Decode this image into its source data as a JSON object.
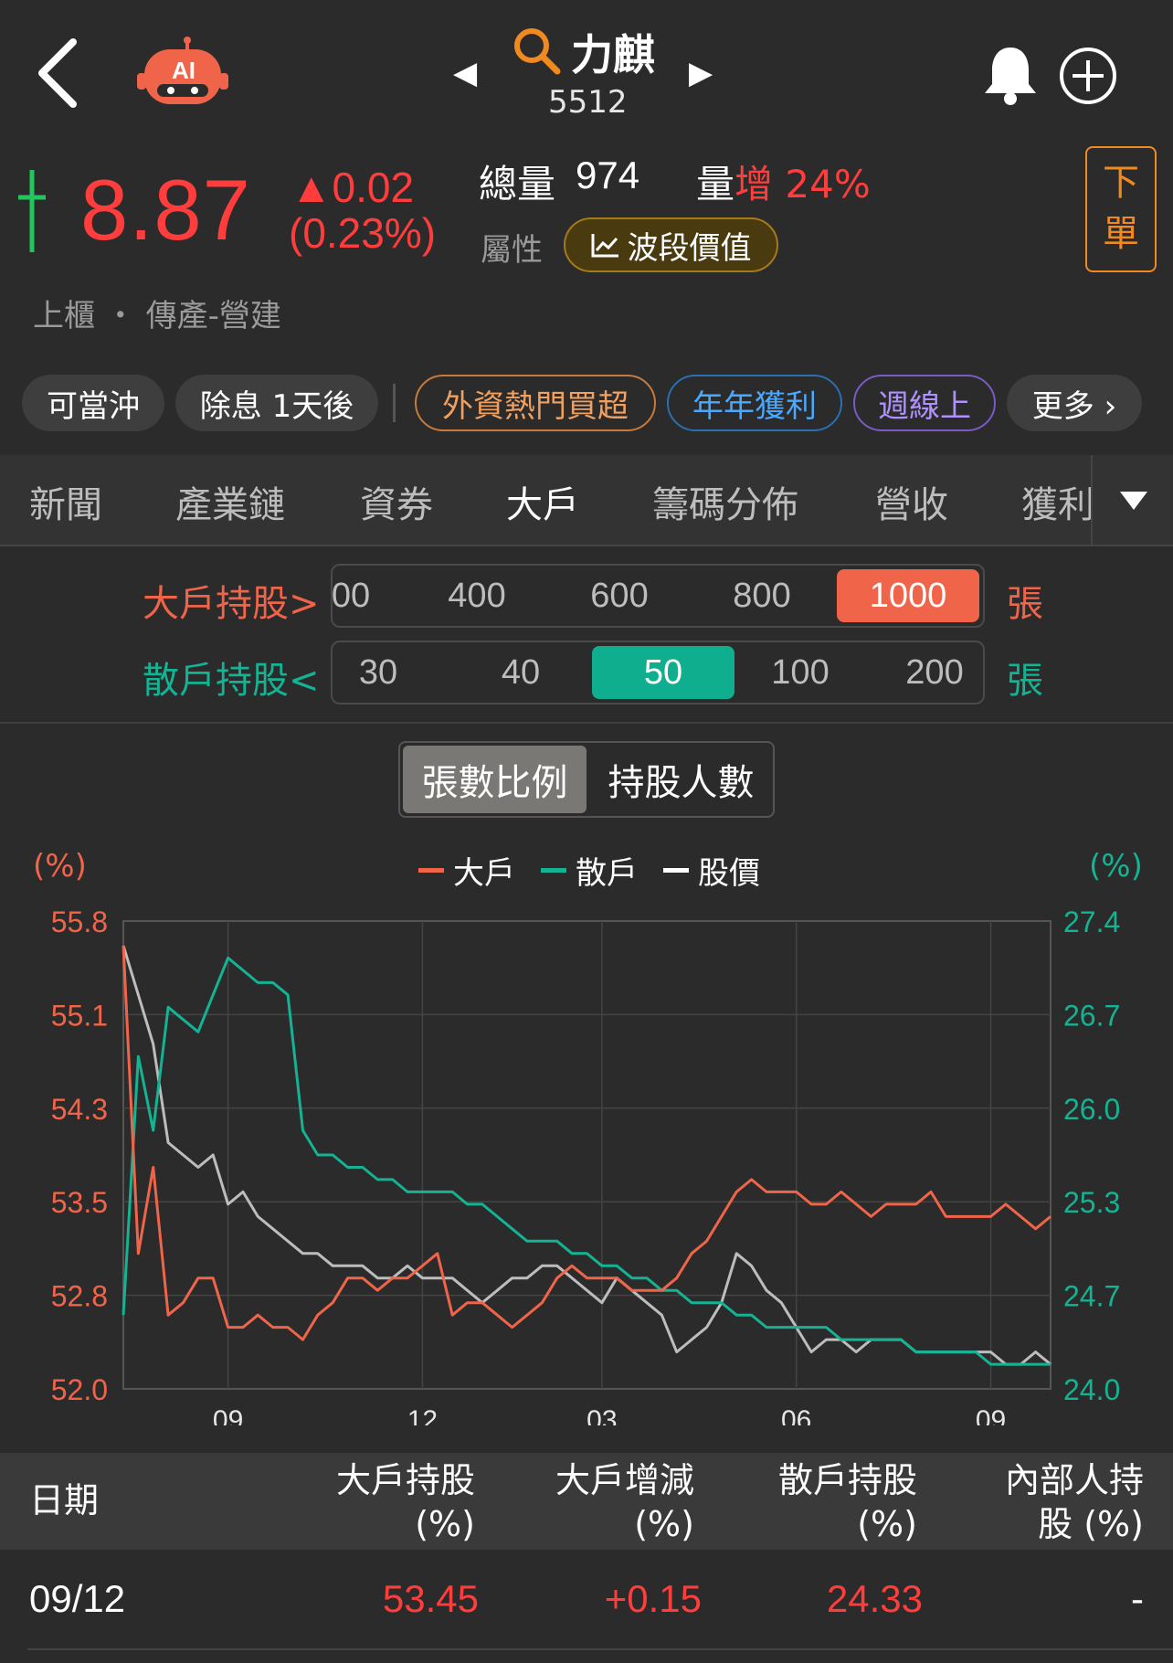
{
  "header": {
    "stock_name": "力麒",
    "stock_code": "5512",
    "prev_arrow": "◀",
    "next_arrow": "▶"
  },
  "quote": {
    "price": "8.87",
    "change": "▲0.02",
    "change_pct": "(0.23%)",
    "volume_label": "總量",
    "volume_value": "974",
    "vol_inc_prefix": "量",
    "vol_inc_word": "增",
    "vol_inc_value": "24%",
    "attribute_label": "屬性",
    "wave_value_label": "波段價值",
    "order_button": "下單",
    "market": "上櫃 ・ 傳產-營建"
  },
  "tags": [
    {
      "label": "可當沖"
    },
    {
      "label": "除息 1天後"
    },
    {
      "label": "外資熱門買超"
    },
    {
      "label": "年年獲利"
    },
    {
      "label": "週線上"
    },
    {
      "label": "更多 ›"
    }
  ],
  "tabs": [
    "新聞",
    "產業鏈",
    "資券",
    "大戶",
    "籌碼分佈",
    "營收",
    "獲利"
  ],
  "active_tab": "大戶",
  "filters": {
    "big_label": "大戶持股>",
    "big_options": [
      "00",
      "400",
      "600",
      "800",
      "1000"
    ],
    "big_selected": "1000",
    "small_label": "散戶持股<",
    "small_options": [
      "30",
      "40",
      "50",
      "100",
      "200"
    ],
    "small_selected": "50",
    "unit": "張"
  },
  "toggle": {
    "options": [
      "張數比例",
      "持股人數"
    ],
    "selected": "張數比例"
  },
  "colors": {
    "big": "#f0654a",
    "small": "#14b393",
    "price": "#bdbdbd",
    "up": "#ff3d3d"
  },
  "chart_data": {
    "type": "line",
    "legend": [
      "大戶",
      "散戶",
      "股價"
    ],
    "left_axis_label": "(%)",
    "right_axis_label": "(%)",
    "left_ticks": [
      "55.8",
      "55.1",
      "54.3",
      "53.5",
      "52.8",
      "52.0"
    ],
    "right_ticks": [
      "27.4",
      "26.7",
      "26.0",
      "25.3",
      "24.7",
      "24.0"
    ],
    "left_range": [
      52.0,
      55.8
    ],
    "right_range": [
      24.0,
      27.4
    ],
    "x_ticks": [
      "09",
      "12",
      "03",
      "06",
      "09"
    ],
    "series": [
      {
        "name": "大戶",
        "axis": "left",
        "values": [
          55.6,
          53.1,
          53.8,
          52.6,
          52.7,
          52.9,
          52.9,
          52.5,
          52.5,
          52.6,
          52.5,
          52.5,
          52.4,
          52.6,
          52.7,
          52.9,
          52.9,
          52.8,
          52.9,
          52.9,
          53.0,
          53.1,
          52.6,
          52.7,
          52.7,
          52.6,
          52.5,
          52.6,
          52.7,
          52.9,
          53.0,
          52.9,
          52.9,
          52.9,
          52.8,
          52.8,
          52.8,
          52.9,
          53.1,
          53.2,
          53.4,
          53.6,
          53.7,
          53.6,
          53.6,
          53.6,
          53.5,
          53.5,
          53.6,
          53.5,
          53.4,
          53.5,
          53.5,
          53.5,
          53.6,
          53.4,
          53.4,
          53.4,
          53.4,
          53.5,
          53.4,
          53.3,
          53.4
        ]
      },
      {
        "name": "散戶",
        "axis": "left",
        "values": [
          52.6,
          54.7,
          54.1,
          55.1,
          55.0,
          54.9,
          55.2,
          55.5,
          55.4,
          55.3,
          55.3,
          55.2,
          54.1,
          53.9,
          53.9,
          53.8,
          53.8,
          53.7,
          53.7,
          53.6,
          53.6,
          53.6,
          53.6,
          53.5,
          53.5,
          53.4,
          53.3,
          53.2,
          53.2,
          53.2,
          53.1,
          53.1,
          53.0,
          53.0,
          52.9,
          52.9,
          52.8,
          52.8,
          52.7,
          52.7,
          52.7,
          52.6,
          52.6,
          52.5,
          52.5,
          52.5,
          52.5,
          52.5,
          52.4,
          52.4,
          52.4,
          52.4,
          52.4,
          52.3,
          52.3,
          52.3,
          52.3,
          52.3,
          52.2,
          52.2,
          52.2,
          52.2,
          52.2
        ]
      },
      {
        "name": "股價",
        "axis": "left",
        "values": [
          55.6,
          55.2,
          54.8,
          54.0,
          53.9,
          53.8,
          53.9,
          53.5,
          53.6,
          53.4,
          53.3,
          53.2,
          53.1,
          53.1,
          53.0,
          53.0,
          53.0,
          52.9,
          52.9,
          53.0,
          52.9,
          52.9,
          52.9,
          52.8,
          52.7,
          52.8,
          52.9,
          52.9,
          53.0,
          53.0,
          52.9,
          52.8,
          52.7,
          52.9,
          52.8,
          52.7,
          52.6,
          52.3,
          52.4,
          52.5,
          52.7,
          53.1,
          53.0,
          52.8,
          52.7,
          52.5,
          52.3,
          52.4,
          52.4,
          52.3,
          52.4,
          52.4,
          52.4,
          52.3,
          52.3,
          52.3,
          52.3,
          52.3,
          52.3,
          52.2,
          52.2,
          52.3,
          52.2
        ]
      }
    ]
  },
  "table": {
    "headers": [
      {
        "line1": "日期",
        "line2": ""
      },
      {
        "line1": "大戶持股",
        "line2": "(%)"
      },
      {
        "line1": "大戶增減",
        "line2": "(%)"
      },
      {
        "line1": "散戶持股",
        "line2": "(%)"
      },
      {
        "line1": "內部人持",
        "line2": "股 (%)"
      }
    ],
    "rows": [
      {
        "date": "09/12",
        "big_hold": "53.45",
        "big_change": "+0.15",
        "small_hold": "24.33",
        "insider": "-"
      }
    ]
  }
}
